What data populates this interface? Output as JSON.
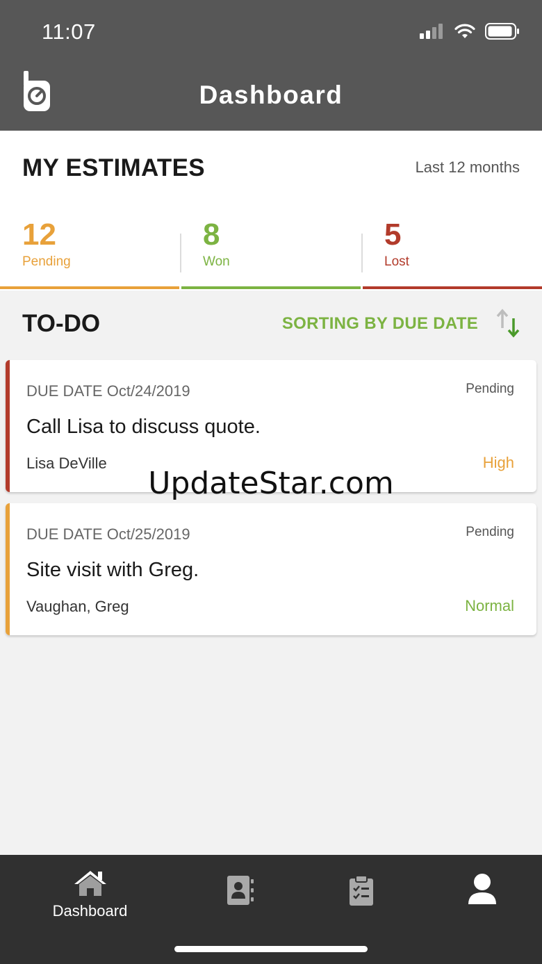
{
  "status_bar": {
    "time": "11:07",
    "signal_icon": "signal-bars-icon",
    "wifi_icon": "wifi-icon",
    "battery_icon": "battery-icon"
  },
  "header": {
    "title": "Dashboard",
    "logo_icon": "app-logo-icon"
  },
  "estimates": {
    "title": "MY ESTIMATES",
    "period": "Last 12 months",
    "stats": [
      {
        "value": "12",
        "label": "Pending",
        "color": "#e8a13a"
      },
      {
        "value": "8",
        "label": "Won",
        "color": "#7cb342"
      },
      {
        "value": "5",
        "label": "Lost",
        "color": "#b23b2b"
      }
    ]
  },
  "todo": {
    "title": "TO-DO",
    "sorting_label": "SORTING BY DUE DATE",
    "sort_icon": "sort-arrows-icon",
    "items": [
      {
        "due": "DUE DATE Oct/24/2019",
        "status": "Pending",
        "title": "Call Lisa to discuss quote.",
        "person": "Lisa DeVille",
        "priority": "High",
        "accent_color": "#b23b2b",
        "priority_color": "#e8a13a"
      },
      {
        "due": "DUE DATE Oct/25/2019",
        "status": "Pending",
        "title": "Site visit with Greg.",
        "person": "Vaughan, Greg",
        "priority": "Normal",
        "accent_color": "#e8a13a",
        "priority_color": "#7cb342"
      }
    ]
  },
  "watermark": "UpdateStar.com",
  "tabbar": {
    "tabs": [
      {
        "label": "Dashboard",
        "icon": "home-icon",
        "active": true
      },
      {
        "label": "",
        "icon": "contacts-icon",
        "active": false
      },
      {
        "label": "",
        "icon": "clipboard-checklist-icon",
        "active": false
      },
      {
        "label": "",
        "icon": "user-profile-icon",
        "active": false
      }
    ]
  }
}
